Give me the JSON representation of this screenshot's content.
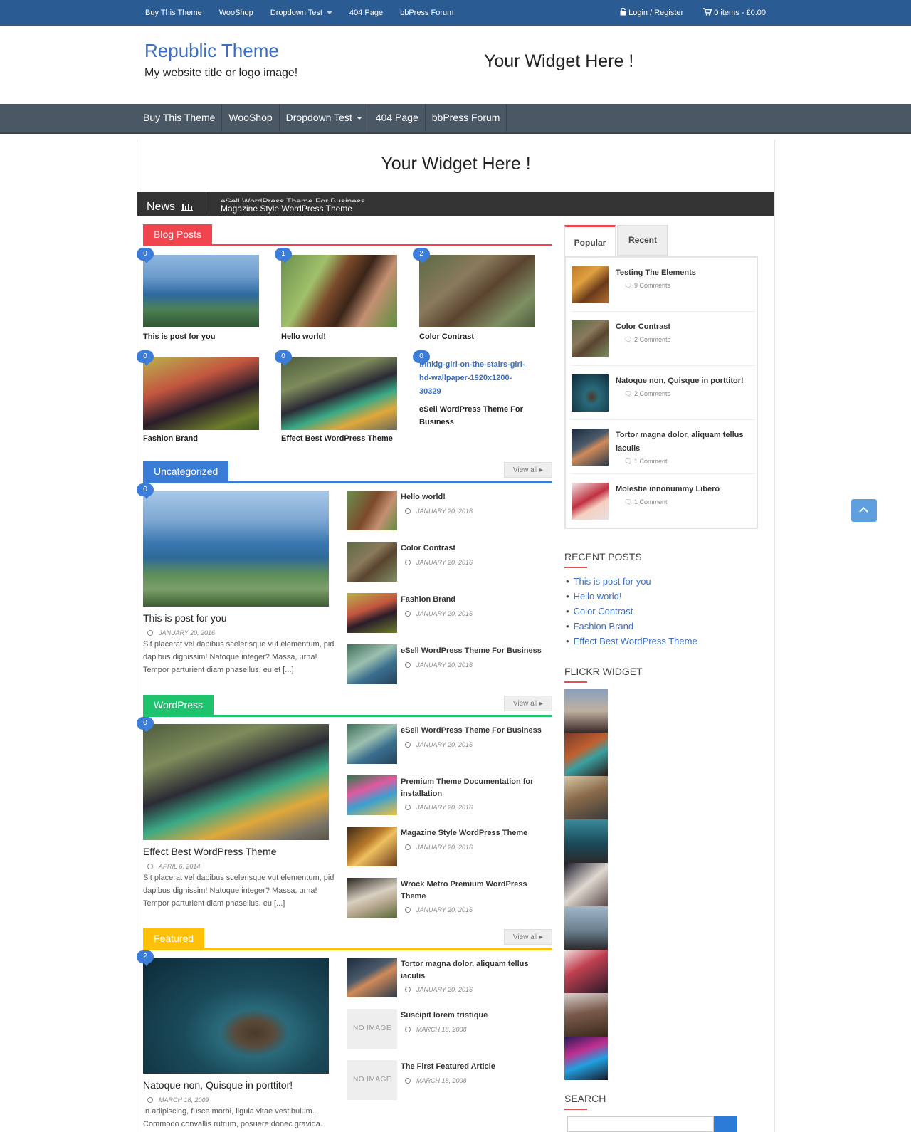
{
  "topbar": {
    "links": [
      "Buy This Theme",
      "WooShop",
      "Dropdown Test",
      "404 Page",
      "bbPress Forum"
    ],
    "login": "Login / Register",
    "cart": "0 items - £0.00"
  },
  "header": {
    "site_title": "Republic Theme",
    "tagline": "My website title or logo image!",
    "widget": "Your Widget Here !"
  },
  "mainnav": {
    "items": [
      "Buy This Theme",
      "WooShop",
      "Dropdown Test",
      "404 Page",
      "bbPress Forum"
    ]
  },
  "content_widget": "Your Widget Here !",
  "news": {
    "label": "News",
    "ticker_prev": "eSell WordPress Theme For Business",
    "ticker": "Magazine Style WordPress Theme"
  },
  "blog_posts": {
    "heading": "Blog Posts",
    "posts": [
      {
        "count": "0",
        "title": "This is post for you"
      },
      {
        "count": "1",
        "title": "Hello world!"
      },
      {
        "count": "2",
        "title": "Color Contrast"
      },
      {
        "count": "0",
        "title": "Fashion Brand"
      },
      {
        "count": "0",
        "title": "Effect Best WordPress Theme"
      },
      {
        "count": "0",
        "link": "thnkig-girl-on-the-stairs-girl-hd-wallpaper-1920x1200-30329",
        "title": "eSell WordPress Theme For Business"
      }
    ]
  },
  "uncategorized": {
    "heading": "Uncategorized",
    "view_all": "View all",
    "featured": {
      "count": "0",
      "title": "This is post for you",
      "date": "JANUARY 20, 2016",
      "excerpt": "Sit placerat vel dapibus scelerisque vut elementum, pid dapibus dignissim! Natoque integer? Massa, urna! Tempor parturient diam phasellus, eu et [...]"
    },
    "list": [
      {
        "title": "Hello world!",
        "date": "JANUARY 20, 2016"
      },
      {
        "title": "Color Contrast",
        "date": "JANUARY 20, 2016"
      },
      {
        "title": "Fashion Brand",
        "date": "JANUARY 20, 2016"
      },
      {
        "title": "eSell WordPress Theme For Business",
        "date": "JANUARY 20, 2016"
      }
    ]
  },
  "wordpress": {
    "heading": "WordPress",
    "view_all": "View all",
    "featured": {
      "count": "0",
      "title": "Effect Best WordPress Theme",
      "date": "APRIL 6, 2014",
      "excerpt": "Sit placerat vel dapibus scelerisque vut elementum, pid dapibus dignissim! Natoque integer? Massa, urna! Tempor parturient diam phasellus, eu [...]"
    },
    "list": [
      {
        "title": "eSell WordPress Theme For Business",
        "date": "JANUARY 20, 2016"
      },
      {
        "title": "Premium Theme Documentation for installation",
        "date": "JANUARY 20, 2016"
      },
      {
        "title": "Magazine Style WordPress Theme",
        "date": "JANUARY 20, 2016"
      },
      {
        "title": "Wrock Metro Premium WordPress Theme",
        "date": "JANUARY 20, 2016"
      }
    ]
  },
  "featured": {
    "heading": "Featured",
    "view_all": "View all",
    "featured": {
      "count": "2",
      "title": "Natoque non, Quisque in porttitor!",
      "date": "MARCH 18, 2009",
      "excerpt": "In adipiscing, fusce morbi, ligula vitae vestibulum. Commodo convallis rutrum, posuere donec gravida."
    },
    "list": [
      {
        "title": "Tortor magna dolor, aliquam tellus iaculis",
        "date": "JANUARY 20, 2016"
      },
      {
        "title": "Suscipit lorem tristique",
        "date": "MARCH 18, 2008",
        "noimage": "NO IMAGE"
      },
      {
        "title": "The First Featured Article",
        "date": "MARCH 18, 2008",
        "noimage": "NO IMAGE"
      }
    ]
  },
  "sidebar": {
    "tabs": [
      "Popular",
      "Recent"
    ],
    "popular": [
      {
        "title": "Testing The Elements",
        "comments": "9 Comments"
      },
      {
        "title": "Color Contrast",
        "comments": "2 Comments"
      },
      {
        "title": "Natoque non, Quisque in porttitor!",
        "comments": "2 Comments"
      },
      {
        "title": "Tortor magna dolor, aliquam tellus iaculis",
        "comments": "1 Comment"
      },
      {
        "title": "Molestie innonummy Libero",
        "comments": "1 Comment"
      }
    ],
    "recent_title": "RECENT POSTS",
    "recent": [
      "This is post for you",
      "Hello world!",
      "Color Contrast",
      "Fashion Brand",
      "Effect Best WordPress Theme"
    ],
    "flickr_title": "FLICKR WIDGET",
    "search_title": "SEARCH"
  },
  "colors": {
    "topbar": "#2b5b93",
    "mainnav": "#4a5866",
    "blog_posts": "#f0444f",
    "uncategorized": "#3a7bd5",
    "wordpress": "#1ec36e",
    "featured": "#ffc107",
    "badge": "#3b7dd8"
  },
  "icons": [
    "lock-icon",
    "cart-icon",
    "bar-chart-icon",
    "clock-icon",
    "comment-icon",
    "chevron-up-icon"
  ]
}
